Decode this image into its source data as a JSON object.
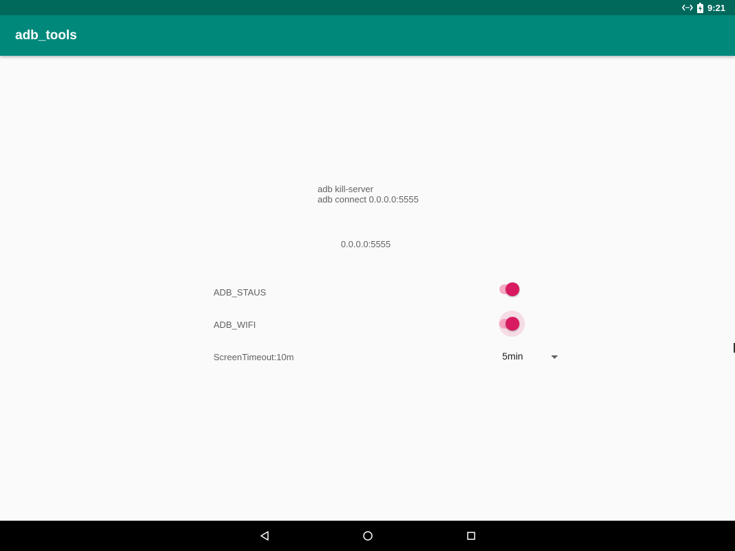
{
  "status_bar": {
    "time": "9:21",
    "icons": [
      "adb-debug-icon",
      "battery-charging-icon"
    ]
  },
  "app_bar": {
    "title": "adb_tools"
  },
  "main": {
    "command_line_1": "adb kill-server",
    "command_line_2": "adb connect 0.0.0.0:5555",
    "address": "0.0.0.0:5555",
    "rows": [
      {
        "label": "ADB_STAUS",
        "control": "switch",
        "checked": true
      },
      {
        "label": "ADB_WIFI",
        "control": "switch",
        "checked": true,
        "pressed": true
      },
      {
        "label": "ScreenTimeout:10m",
        "control": "spinner",
        "value": "5min"
      }
    ]
  },
  "nav_bar": {
    "icons": [
      "back-icon",
      "home-icon",
      "recents-icon"
    ]
  },
  "colors": {
    "status_bar": "#00695c",
    "app_bar": "#00897b",
    "accent": "#d81b60",
    "background": "#fafafa"
  }
}
